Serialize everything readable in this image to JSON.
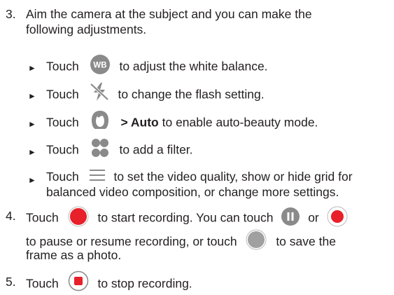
{
  "steps": [
    {
      "number": "3.",
      "line1": "Aim the camera at the subject and you can make the",
      "line2": "following adjustments."
    },
    {
      "number": "4.",
      "line1_a": "Touch",
      "line1_b": "to start recording. You can touch",
      "line1_c": "or",
      "line2_a": "to pause or resume recording, or touch",
      "line2_b": "to save the",
      "line3": "frame as a photo."
    },
    {
      "number": "5.",
      "part_a": "Touch",
      "part_b": "to stop recording."
    }
  ],
  "bullets": [
    {
      "marker": "►",
      "pre": "Touch",
      "post": "to adjust the white balance.",
      "icon": "white-balance-icon",
      "icon_text": "WB"
    },
    {
      "marker": "►",
      "pre": "Touch",
      "post": "to change the flash setting.",
      "icon": "flash-off-icon"
    },
    {
      "marker": "►",
      "pre": "Touch",
      "bold": "> Auto",
      "post": "to enable auto-beauty mode.",
      "icon": "beauty-face-icon"
    },
    {
      "marker": "►",
      "pre": "Touch",
      "post": "to add a filter.",
      "icon": "filter-icon"
    },
    {
      "marker": "►",
      "pre": "Touch",
      "post": "to set the video quality, show or hide grid for",
      "post2": "balanced video composition, or change more settings.",
      "icon": "menu-icon"
    }
  ],
  "colors": {
    "text": "#231f20",
    "icon_gray": "#8a8a8a",
    "record_red": "#e8202a"
  }
}
